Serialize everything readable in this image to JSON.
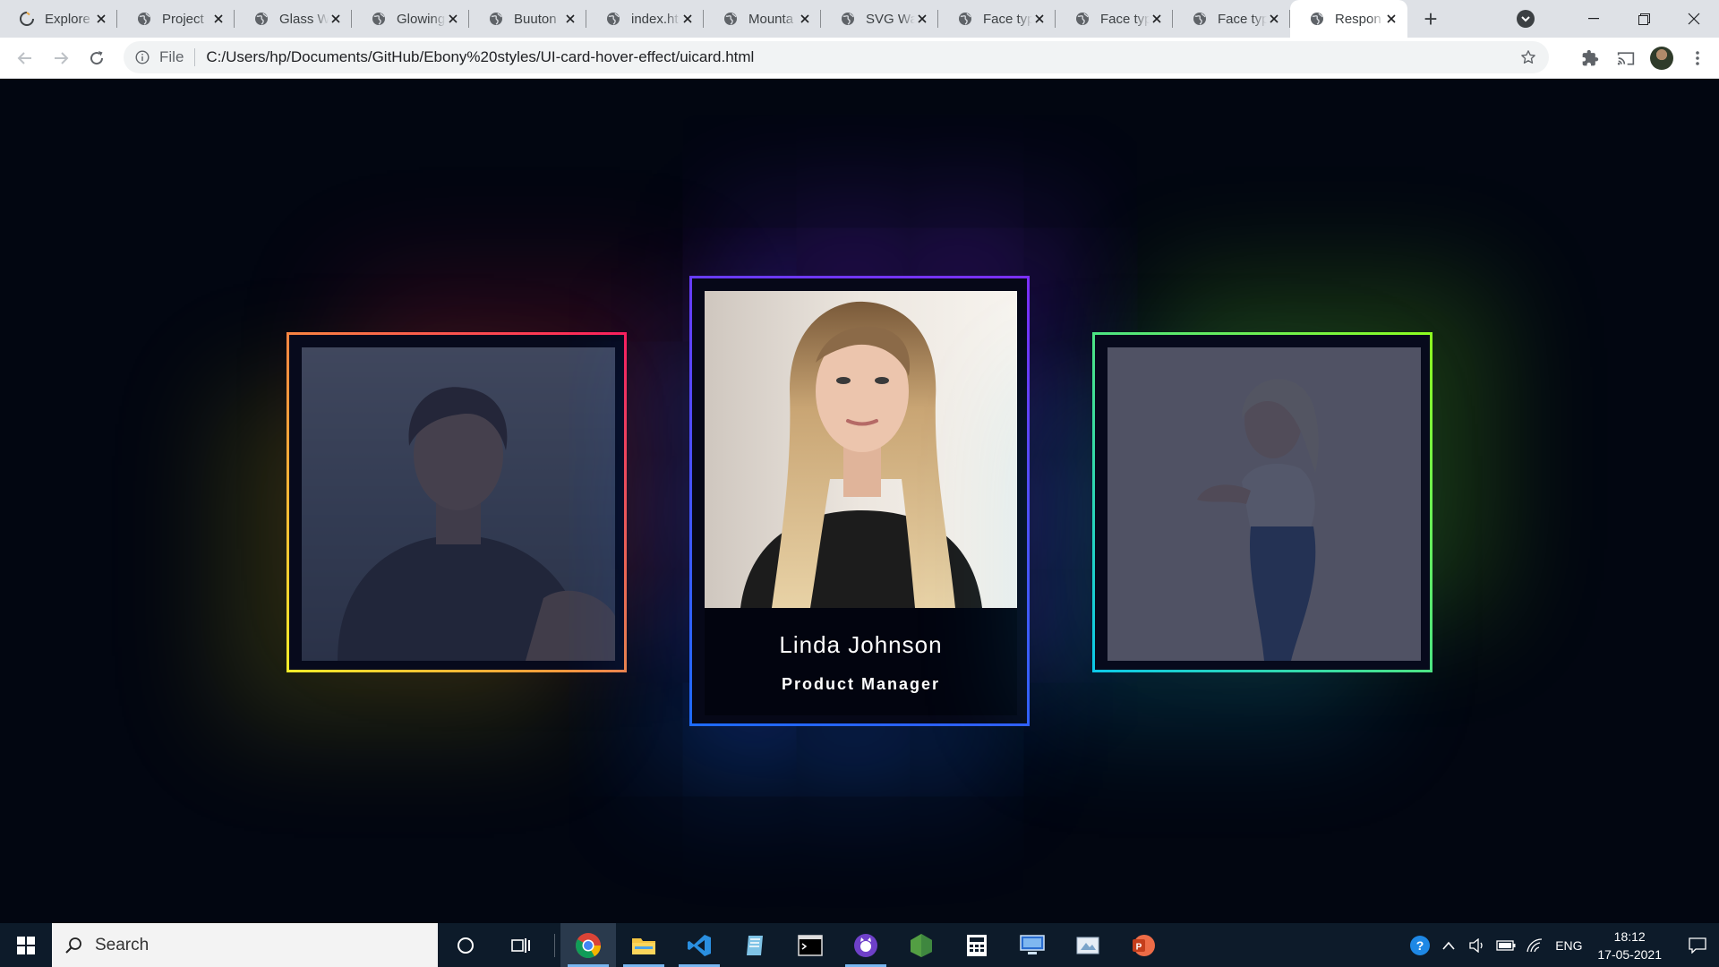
{
  "browser": {
    "tabs": [
      {
        "title": "Explore",
        "favicon": "spinner-icon"
      },
      {
        "title": "Project",
        "favicon": "globe-icon"
      },
      {
        "title": "Glass W",
        "favicon": "globe-icon"
      },
      {
        "title": "Glowing",
        "favicon": "globe-icon"
      },
      {
        "title": "Buuton",
        "favicon": "globe-icon"
      },
      {
        "title": "index.ht",
        "favicon": "globe-icon"
      },
      {
        "title": "Mounta",
        "favicon": "globe-icon"
      },
      {
        "title": "SVG Wa",
        "favicon": "globe-icon"
      },
      {
        "title": "Face typ",
        "favicon": "globe-icon"
      },
      {
        "title": "Face typ",
        "favicon": "globe-icon"
      },
      {
        "title": "Face typ",
        "favicon": "globe-icon"
      },
      {
        "title": "Respon",
        "favicon": "globe-icon",
        "active": true
      }
    ],
    "address": {
      "scheme_label": "File",
      "url": "C:/Users/hp/Documents/GitHub/Ebony%20styles/UI-card-hover-effect/uicard.html"
    }
  },
  "cards": [
    {
      "id": "left",
      "image": "young man in black t-shirt by the sea",
      "border_colors": [
        "#f3ec29",
        "#ff1e5a"
      ]
    },
    {
      "id": "center",
      "image": "blonde woman portrait",
      "name": "Linda Johnson",
      "role": "Product Manager",
      "border_colors": [
        "#1e6bff",
        "#7b2fff"
      ]
    },
    {
      "id": "right",
      "image": "blonde woman in jeans",
      "border_colors": [
        "#0cc8e8",
        "#8dff1f"
      ]
    }
  ],
  "taskbar": {
    "search_label": "Search",
    "apps": [
      "chrome-icon",
      "file-explorer-icon",
      "vscode-icon",
      "notepad-icon",
      "terminal-icon",
      "github-desktop-icon",
      "nodejs-icon",
      "calculator-icon",
      "remote-desktop-icon",
      "paint-icon",
      "powerpoint-icon"
    ],
    "tray": {
      "language": "ENG",
      "time": "18:12",
      "date": "17-05-2021"
    }
  }
}
